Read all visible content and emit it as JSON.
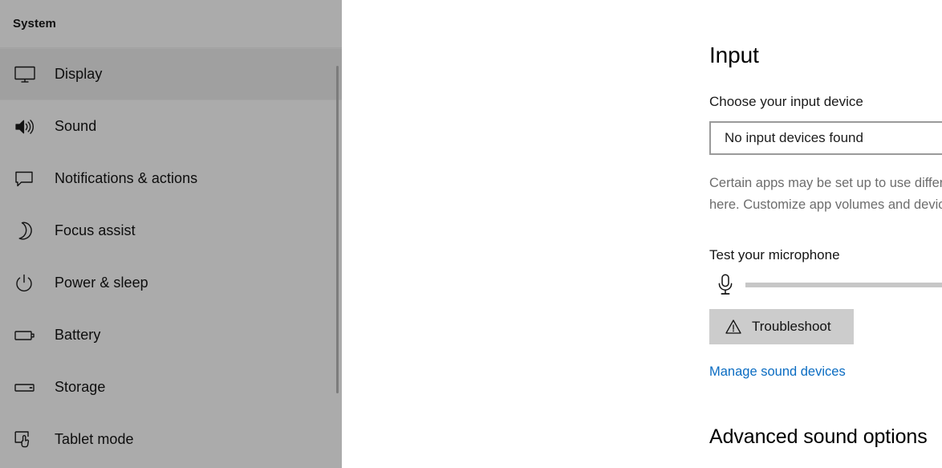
{
  "sidebar": {
    "title": "System",
    "items": [
      {
        "label": "Display",
        "icon": "monitor-icon",
        "selected": true
      },
      {
        "label": "Sound",
        "icon": "speaker-icon",
        "selected": false
      },
      {
        "label": "Notifications & actions",
        "icon": "chat-bubble-icon",
        "selected": false
      },
      {
        "label": "Focus assist",
        "icon": "moon-icon",
        "selected": false
      },
      {
        "label": "Power & sleep",
        "icon": "power-icon",
        "selected": false
      },
      {
        "label": "Battery",
        "icon": "battery-icon",
        "selected": false
      },
      {
        "label": "Storage",
        "icon": "storage-icon",
        "selected": false
      },
      {
        "label": "Tablet mode",
        "icon": "tablet-hand-icon",
        "selected": false
      }
    ],
    "scrollbar": {
      "visible": true
    }
  },
  "main": {
    "page_title": "Input",
    "input_device": {
      "label": "Choose your input device",
      "selected_value": "No input devices found",
      "chevron_icon": "chevron-down-icon"
    },
    "description": "Certain apps may be set up to use different sound devices than the one selected here. Customize app volumes and devices in advanced sound options.",
    "test_microphone": {
      "label": "Test your microphone",
      "mic_icon": "microphone-icon",
      "level_percent": 0
    },
    "troubleshoot": {
      "label": "Troubleshoot",
      "icon": "warning-triangle-icon"
    },
    "manage_link": "Manage sound devices",
    "advanced_section_title": "Advanced sound options"
  },
  "colors": {
    "sidebar_bg": "#ababab",
    "sidebar_selected_bg": "#a0a0a0",
    "link": "#0a6cc2",
    "button_bg": "#cccccc",
    "level_bar": "#c7c7c7",
    "description_text": "#6d6d6d"
  }
}
